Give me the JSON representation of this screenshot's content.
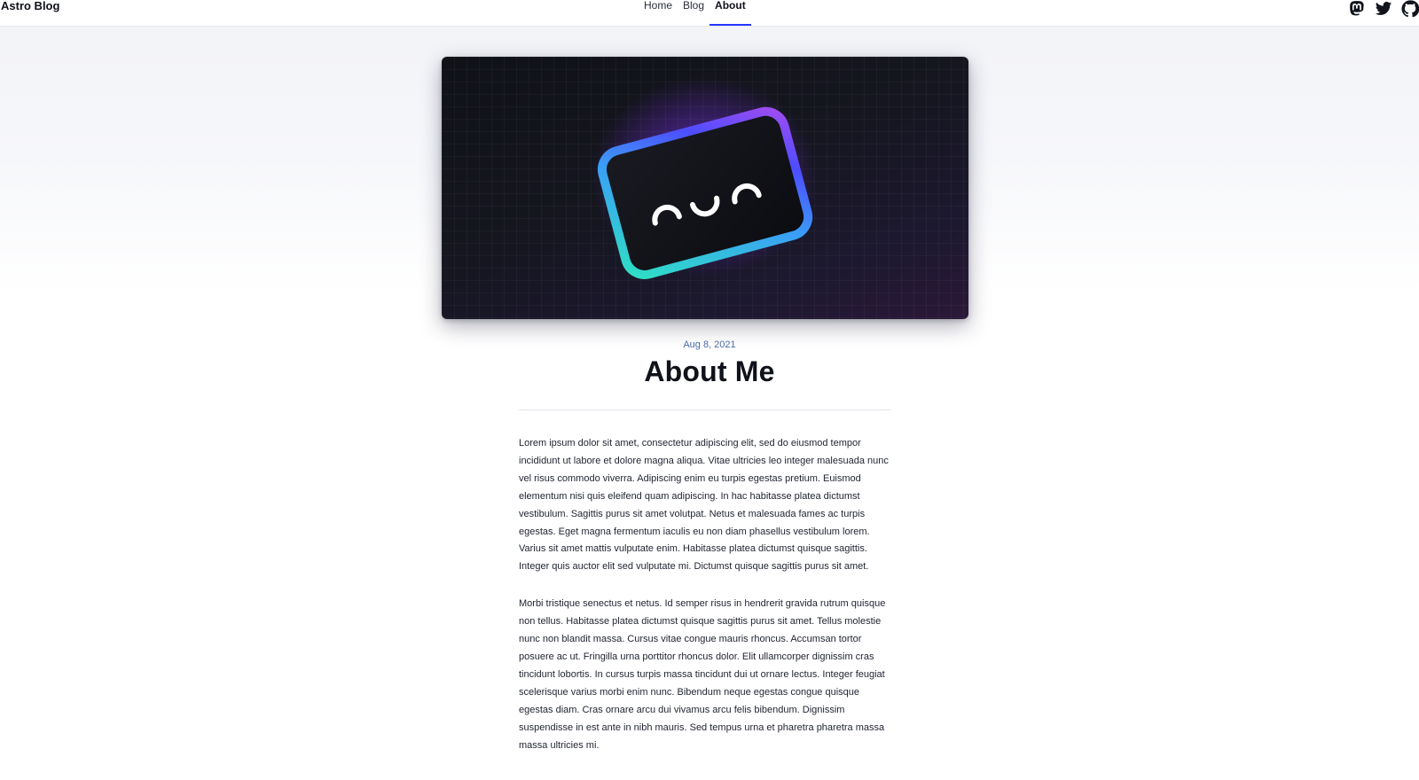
{
  "header": {
    "brand": "Astro Blog",
    "nav": [
      {
        "label": "Home",
        "active": false
      },
      {
        "label": "Blog",
        "active": false
      },
      {
        "label": "About",
        "active": true
      }
    ],
    "social_icons": [
      "mastodon-icon",
      "twitter-icon",
      "github-icon"
    ],
    "accent_color": "#2337ff"
  },
  "hero": {
    "icon": "smiling-face-card-illustration"
  },
  "article": {
    "date": "Aug 8, 2021",
    "title": "About Me",
    "paragraphs": [
      "Lorem ipsum dolor sit amet, consectetur adipiscing elit, sed do eiusmod tempor incididunt ut labore et dolore magna aliqua. Vitae ultricies leo integer malesuada nunc vel risus commodo viverra. Adipiscing enim eu turpis egestas pretium. Euismod elementum nisi quis eleifend quam adipiscing. In hac habitasse platea dictumst vestibulum. Sagittis purus sit amet volutpat. Netus et malesuada fames ac turpis egestas. Eget magna fermentum iaculis eu non diam phasellus vestibulum lorem. Varius sit amet mattis vulputate enim. Habitasse platea dictumst quisque sagittis. Integer quis auctor elit sed vulputate mi. Dictumst quisque sagittis purus sit amet.",
      "Morbi tristique senectus et netus. Id semper risus in hendrerit gravida rutrum quisque non tellus. Habitasse platea dictumst quisque sagittis purus sit amet. Tellus molestie nunc non blandit massa. Cursus vitae congue mauris rhoncus. Accumsan tortor posuere ac ut. Fringilla urna porttitor rhoncus dolor. Elit ullamcorper dignissim cras tincidunt lobortis. In cursus turpis massa tincidunt dui ut ornare lectus. Integer feugiat scelerisque varius morbi enim nunc. Bibendum neque egestas congue quisque egestas diam. Cras ornare arcu dui vivamus arcu felis bibendum. Dignissim suspendisse in est ante in nibh mauris. Sed tempus urna et pharetra pharetra massa massa ultricies mi."
    ]
  }
}
